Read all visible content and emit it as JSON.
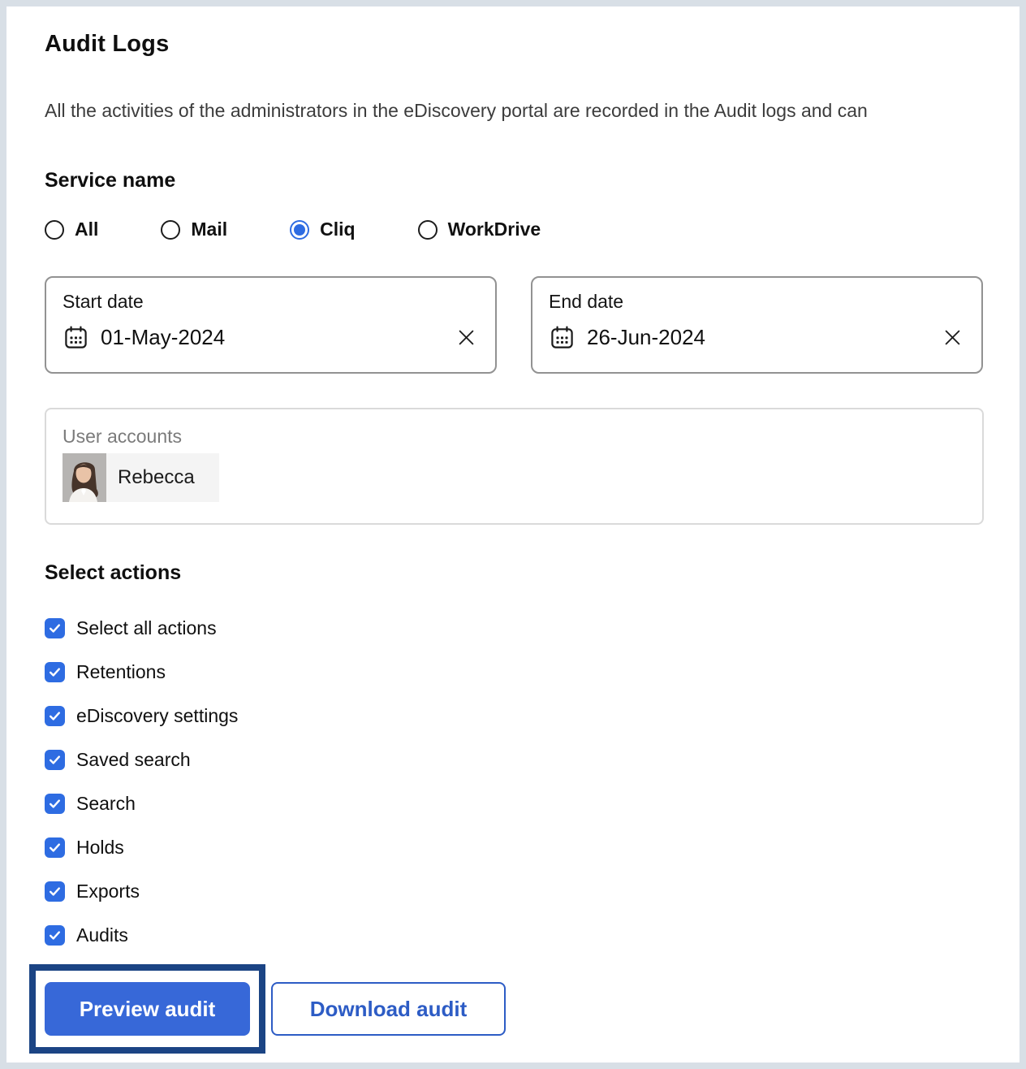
{
  "page": {
    "title": "Audit Logs",
    "description": "All the activities of the administrators in the eDiscovery portal are recorded in the Audit logs and can"
  },
  "service": {
    "heading": "Service name",
    "options": [
      {
        "label": "All",
        "selected": false
      },
      {
        "label": "Mail",
        "selected": false
      },
      {
        "label": "Cliq",
        "selected": true
      },
      {
        "label": "WorkDrive",
        "selected": false
      }
    ]
  },
  "dates": {
    "start": {
      "label": "Start date",
      "value": "01-May-2024"
    },
    "end": {
      "label": "End date",
      "value": "26-Jun-2024"
    }
  },
  "user_accounts": {
    "label": "User accounts",
    "chips": [
      {
        "name": "Rebecca"
      }
    ]
  },
  "actions": {
    "heading": "Select actions",
    "items": [
      {
        "label": "Select all actions",
        "checked": true
      },
      {
        "label": "Retentions",
        "checked": true
      },
      {
        "label": "eDiscovery settings",
        "checked": true
      },
      {
        "label": "Saved search",
        "checked": true
      },
      {
        "label": "Search",
        "checked": true
      },
      {
        "label": "Holds",
        "checked": true
      },
      {
        "label": "Exports",
        "checked": true
      },
      {
        "label": "Audits",
        "checked": true
      }
    ]
  },
  "buttons": {
    "preview": "Preview audit",
    "download": "Download audit"
  },
  "icons": {
    "calendar": "calendar-icon",
    "clear": "close-icon",
    "check": "check-icon"
  },
  "colors": {
    "control_blue": "#2e6ce2",
    "primary_button_blue": "#3768d8",
    "outline_button_blue": "#2d5cc5",
    "annotation_navy": "#1b4484",
    "frame_gray": "#d8dfe6"
  }
}
